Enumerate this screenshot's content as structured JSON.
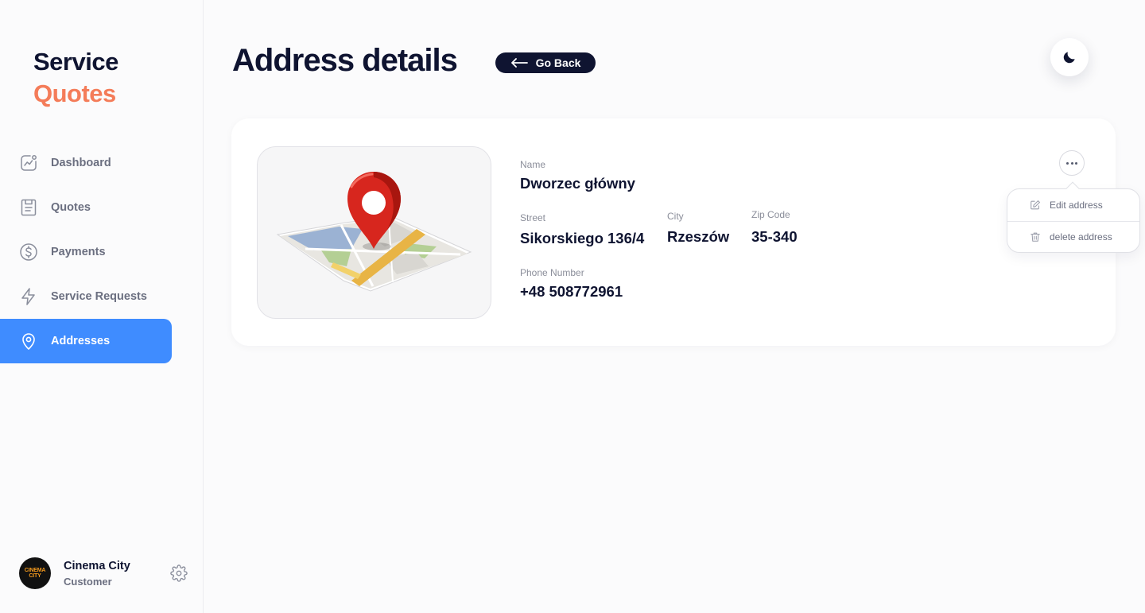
{
  "brand": {
    "line1": "Service",
    "line2": "Quotes"
  },
  "sidebar": {
    "items": [
      {
        "label": "Dashboard",
        "icon": "chart-icon",
        "active": false
      },
      {
        "label": "Quotes",
        "icon": "document-icon",
        "active": false
      },
      {
        "label": "Payments",
        "icon": "dollar-icon",
        "active": false
      },
      {
        "label": "Service Requests",
        "icon": "lightning-icon",
        "active": false
      },
      {
        "label": "Addresses",
        "icon": "location-pin-icon",
        "active": true
      }
    ]
  },
  "profile": {
    "name": "Cinema City",
    "role": "Customer",
    "avatar_text_1": "CINEMA",
    "avatar_text_2": "CITY"
  },
  "header": {
    "title": "Address details",
    "back_label": "Go Back"
  },
  "address": {
    "name_label": "Name",
    "name": "Dworzec główny",
    "street_label": "Street",
    "street": "Sikorskiego 136/4",
    "city_label": "City",
    "city": "Rzeszów",
    "zip_label": "Zip Code",
    "zip": "35-340",
    "phone_label": "Phone Number",
    "phone": "+48 508772961"
  },
  "menu": {
    "edit_label": "Edit address",
    "delete_label": "delete address"
  },
  "colors": {
    "accent": "#3f8cff",
    "brand_orange": "#f47c59",
    "dark": "#0f1431"
  }
}
